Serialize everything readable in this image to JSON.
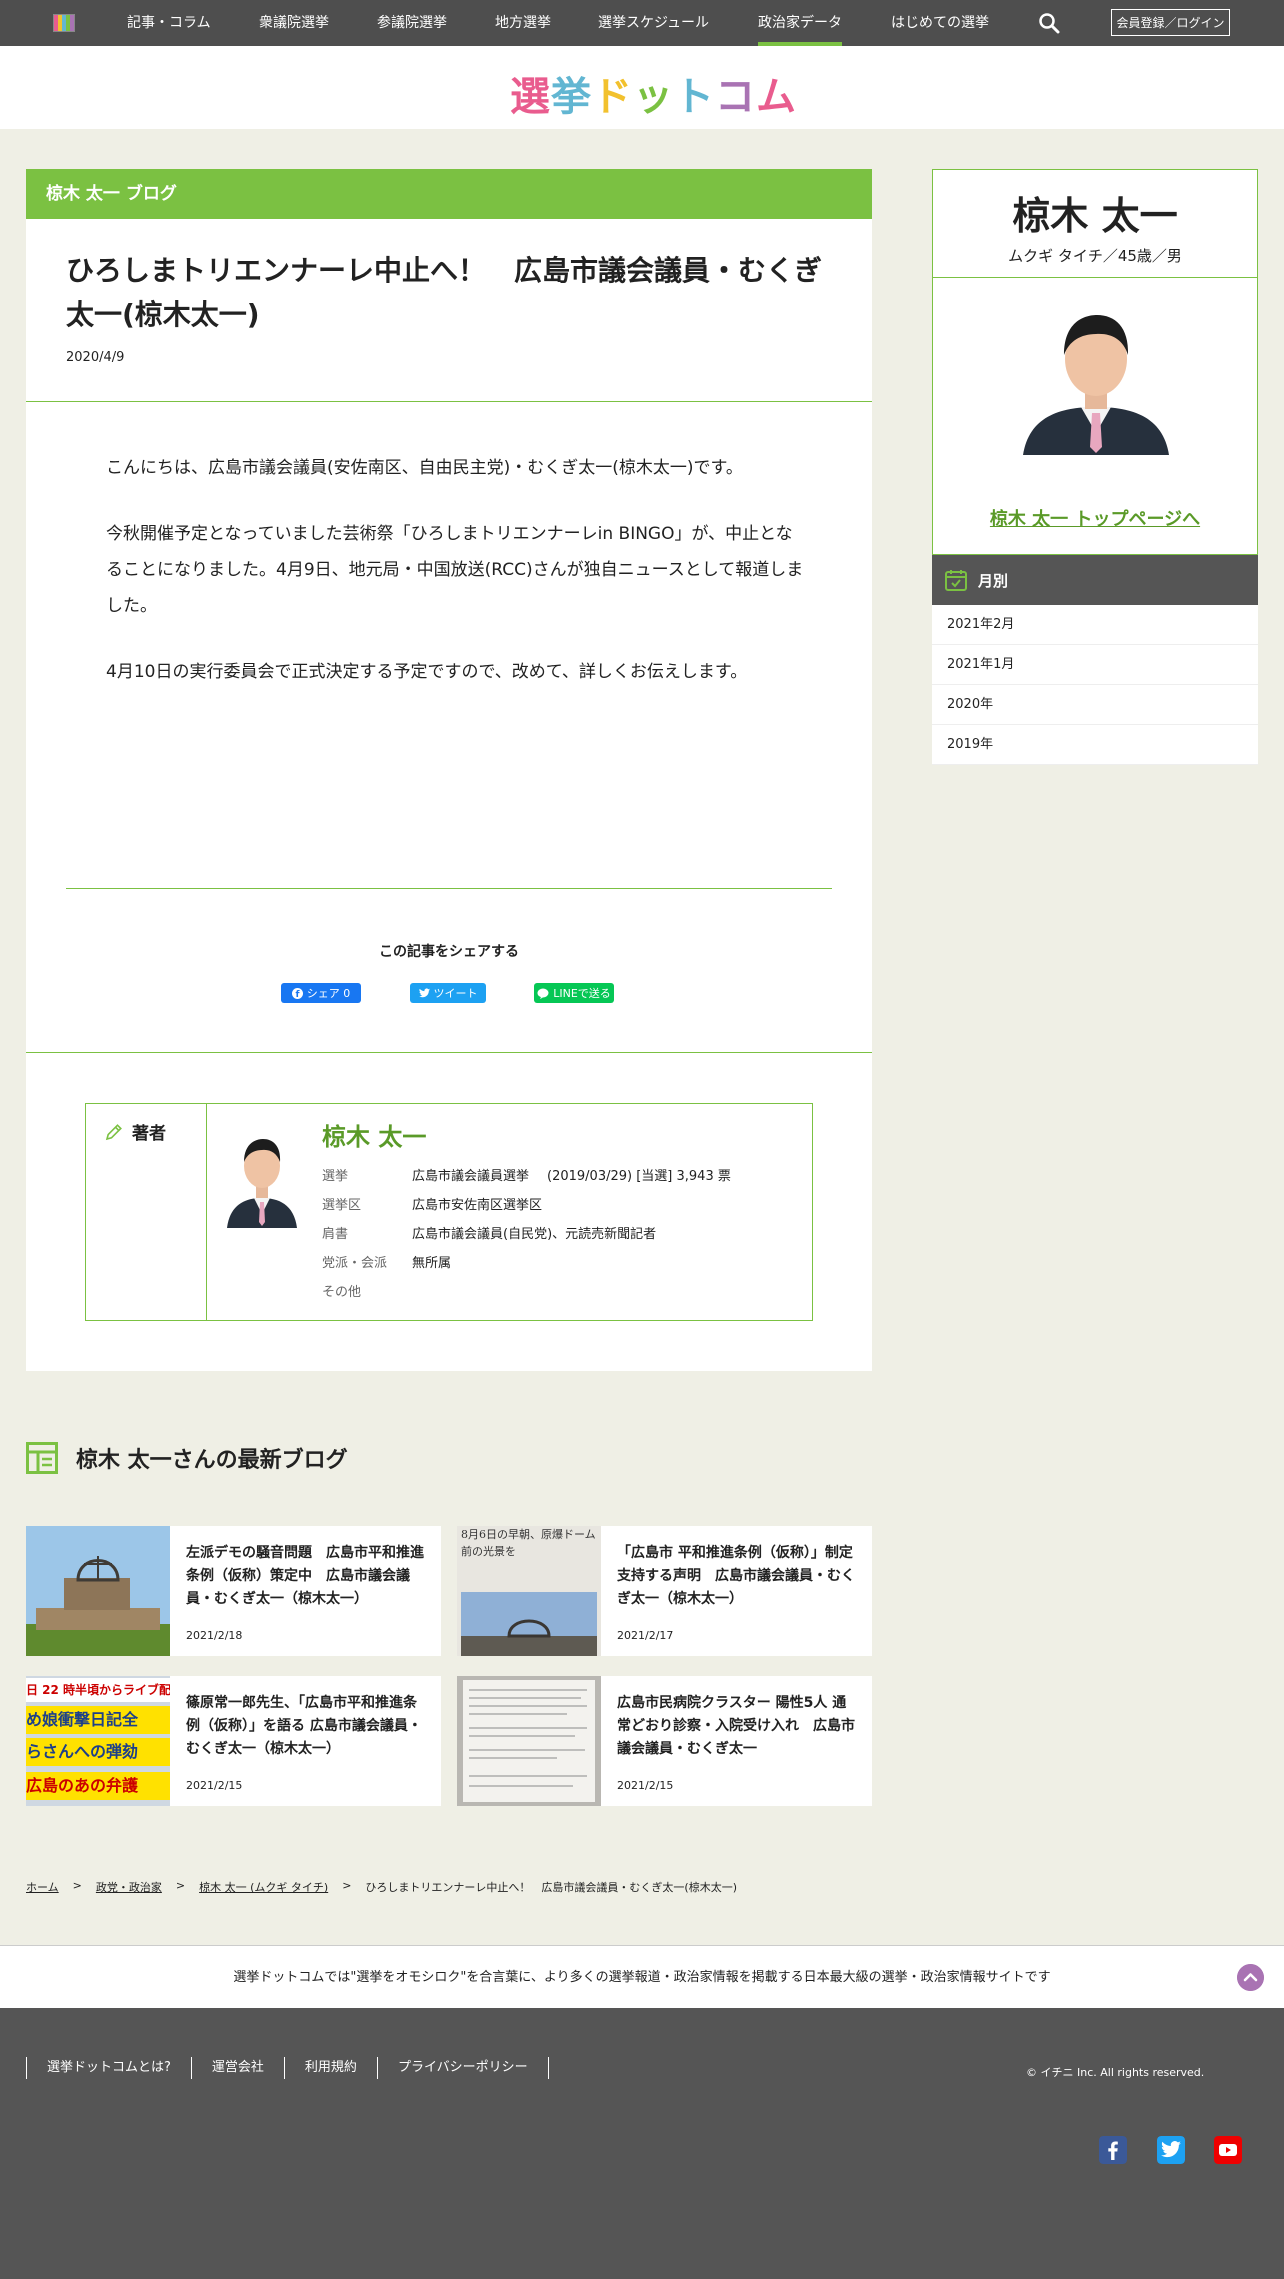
{
  "nav": {
    "items": [
      "記事・コラム",
      "衆議院選挙",
      "参議院選挙",
      "地方選挙",
      "選挙スケジュール",
      "政治家データ",
      "はじめての選挙"
    ],
    "active": "政治家データ",
    "login_label": "会員登録／ログイン"
  },
  "site": {
    "logo_text": "選挙ドットコム"
  },
  "article": {
    "blog_label": "椋木 太一 ブログ",
    "title": "ひろしまトリエンナーレ中止へ！　広島市議会議員・むくぎ太一(椋木太一)",
    "date": "2020/4/9",
    "paragraphs": [
      "こんにちは、広島市議会議員(安佐南区、自由民主党)・むくぎ太一(椋木太一)です。",
      "今秋開催予定となっていました芸術祭「ひろしまトリエンナーレin BINGO」が、中止となることになりました。4月9日、地元局・中国放送(RCC)さんが独自ニュースとして報道しました。",
      "4月10日の実行委員会で正式決定する予定ですので、改めて、詳しくお伝えします。"
    ],
    "share_title": "この記事をシェアする",
    "share_facebook": "シェア 0",
    "share_twitter": "ツイート",
    "share_line": "LINEで送る"
  },
  "author": {
    "label": "著者",
    "name": "椋木 太一",
    "election_key": "選挙",
    "election_link": "広島市議会議員選挙",
    "election_result": "(2019/03/29) [当選] 3,943 票",
    "district_key": "選挙区",
    "district_link": "広島市安佐南区選挙区",
    "title_key": "肩書",
    "title_value": "広島市議会議員(自民党)、元読売新聞記者",
    "party_key": "党派・会派",
    "party_value": "無所属",
    "other_key": "その他"
  },
  "profile": {
    "name": "椋木 太一",
    "sub": "ムクギ タイチ／45歳／男",
    "top_link": "椋木 太一 トップページへ"
  },
  "monthly": {
    "title": "月別",
    "items": [
      "2021年2月",
      "2021年1月",
      "2020年",
      "2019年"
    ]
  },
  "latest": {
    "heading": "椋木 太一さんの最新ブログ",
    "cards": [
      {
        "title": "左派デモの騒音問題　広島市平和推進条例（仮称）策定中　広島市議会議員・むくぎ太一（椋木太一）",
        "date": "2021/2/18"
      },
      {
        "title": "「広島市 平和推進条例（仮称）」制定支持する声明　広島市議会議員・むくぎ太一（椋木太一）",
        "date": "2021/2/17"
      },
      {
        "title": "篠原常一郎先生、「広島市平和推進条例（仮称）」を語る 広島市議会議員・むくぎ太一（椋木太一）",
        "date": "2021/2/15"
      },
      {
        "title": "広島市民病院クラスター 陽性5人 通常どおり診察・入院受け入れ　広島市議会議員・むくぎ太一",
        "date": "2021/2/15"
      }
    ],
    "thumb2_text": "8月6日の早朝、原爆ドーム前の光景を",
    "thumb3_lines": [
      "日 22 時半頃からライブ配",
      "め娘衝撃日記全",
      "らさんへの弾劾",
      "広島のあの弁護"
    ]
  },
  "breadcrumb": [
    "ホーム",
    "政党・政治家",
    "椋木 太一 (ムクギ タイチ)",
    "ひろしまトリエンナーレ中止へ！　広島市議会議員・むくぎ太一(椋木太一)"
  ],
  "tagline": "選挙ドットコムでは\"選挙をオモシロク\"を合言葉に、より多くの選挙報道・政治家情報を掲載する日本最大級の選挙・政治家情報サイトです",
  "footer": {
    "links": [
      "選挙ドットコムとは?",
      "運営会社",
      "利用規約",
      "プライバシーポリシー"
    ],
    "copyright": "© イチニ Inc. All rights reserved."
  },
  "colors": {
    "accent": "#7bc142",
    "dark": "#555555"
  }
}
